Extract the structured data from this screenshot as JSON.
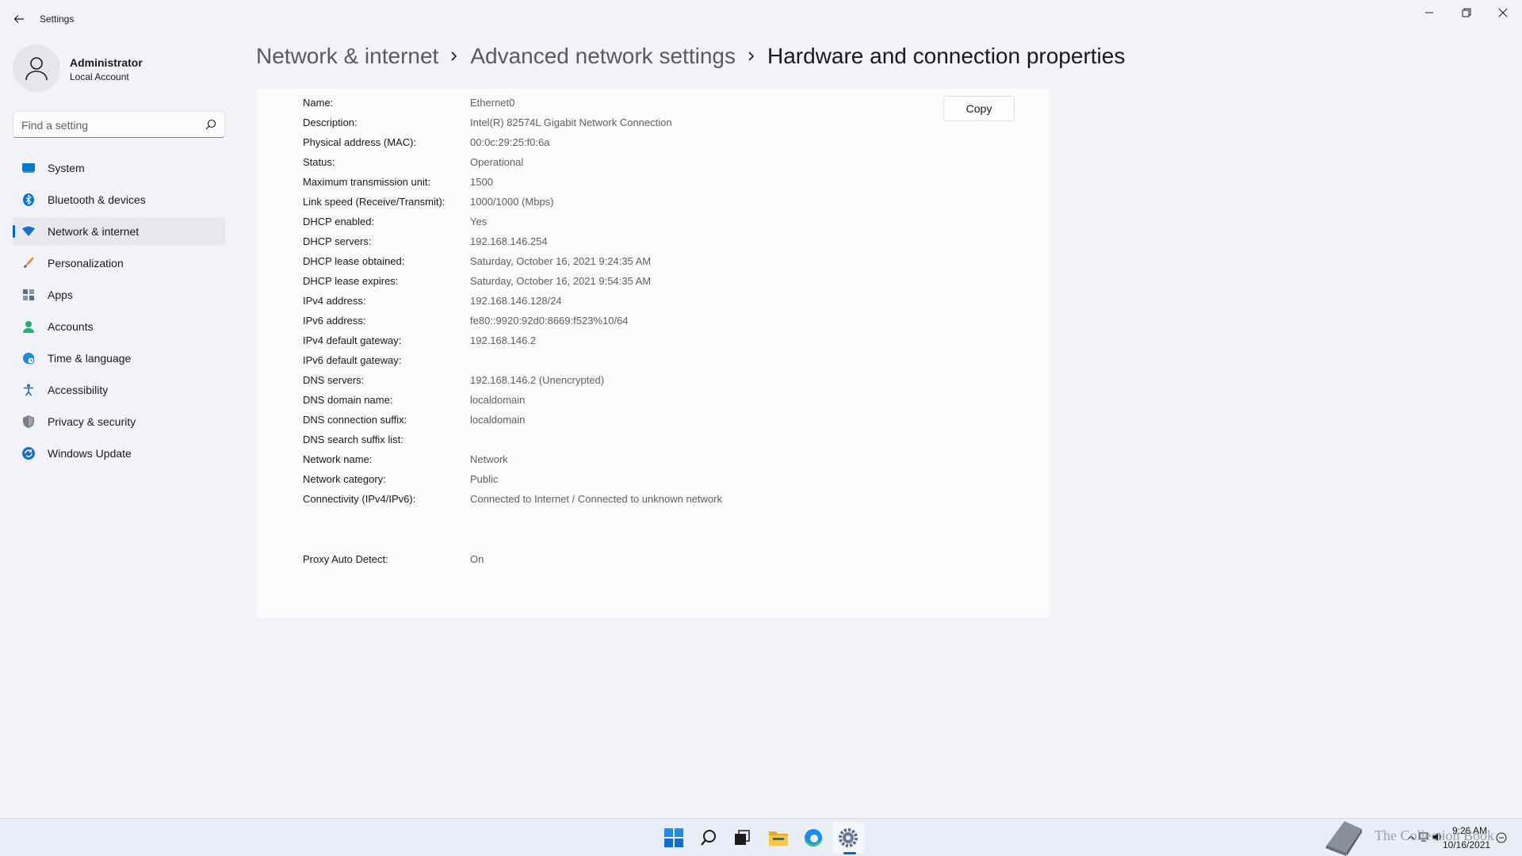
{
  "window": {
    "title": "Settings"
  },
  "profile": {
    "name": "Administrator",
    "subtitle": "Local Account"
  },
  "search": {
    "placeholder": "Find a setting"
  },
  "sidebar": {
    "items": [
      {
        "label": "System",
        "icon": "monitor-icon",
        "color": "#0078d4"
      },
      {
        "label": "Bluetooth & devices",
        "icon": "bluetooth-icon",
        "color": "#0078d4"
      },
      {
        "label": "Network & internet",
        "icon": "wifi-icon",
        "color": "#1b6fc2",
        "active": true
      },
      {
        "label": "Personalization",
        "icon": "brush-icon",
        "color": "#e08a3c"
      },
      {
        "label": "Apps",
        "icon": "apps-icon",
        "color": "#5b6b8a"
      },
      {
        "label": "Accounts",
        "icon": "person-icon",
        "color": "#2aa876"
      },
      {
        "label": "Time & language",
        "icon": "globe-clock-icon",
        "color": "#1b8fd6"
      },
      {
        "label": "Accessibility",
        "icon": "accessibility-icon",
        "color": "#1b6fc2"
      },
      {
        "label": "Privacy & security",
        "icon": "shield-icon",
        "color": "#7a7f8a"
      },
      {
        "label": "Windows Update",
        "icon": "update-icon",
        "color": "#1b6fc2"
      }
    ]
  },
  "breadcrumb": {
    "items": [
      "Network & internet",
      "Advanced network settings"
    ],
    "current": "Hardware and connection properties"
  },
  "panel": {
    "copy_label": "Copy",
    "properties": [
      {
        "label": "Name:",
        "value": "Ethernet0"
      },
      {
        "label": "Description:",
        "value": "Intel(R) 82574L Gigabit Network Connection"
      },
      {
        "label": "Physical address (MAC):",
        "value": "00:0c:29:25:f0:6a"
      },
      {
        "label": "Status:",
        "value": "Operational"
      },
      {
        "label": "Maximum transmission unit:",
        "value": "1500"
      },
      {
        "label": "Link speed (Receive/Transmit):",
        "value": "1000/1000 (Mbps)"
      },
      {
        "label": "DHCP enabled:",
        "value": "Yes"
      },
      {
        "label": "DHCP servers:",
        "value": "192.168.146.254"
      },
      {
        "label": "DHCP lease obtained:",
        "value": "Saturday, October 16, 2021 9:24:35 AM"
      },
      {
        "label": "DHCP lease expires:",
        "value": "Saturday, October 16, 2021 9:54:35 AM"
      },
      {
        "label": "IPv4 address:",
        "value": "192.168.146.128/24"
      },
      {
        "label": "IPv6 address:",
        "value": "fe80::9920:92d0:8669:f523%10/64"
      },
      {
        "label": "IPv4 default gateway:",
        "value": "192.168.146.2"
      },
      {
        "label": "IPv6 default gateway:",
        "value": ""
      },
      {
        "label": "DNS servers:",
        "value": "192.168.146.2 (Unencrypted)"
      },
      {
        "label": "DNS domain name:",
        "value": "localdomain"
      },
      {
        "label": "DNS connection suffix:",
        "value": "localdomain"
      },
      {
        "label": "DNS search suffix list:",
        "value": ""
      },
      {
        "label": "Network name:",
        "value": "Network"
      },
      {
        "label": "Network category:",
        "value": "Public"
      },
      {
        "label": "Connectivity (IPv4/IPv6):",
        "value": "Connected to Internet / Connected to unknown network"
      }
    ],
    "proxy": {
      "label": "Proxy Auto Detect:",
      "value": "On"
    }
  },
  "taskbar": {
    "apps": [
      "start-icon",
      "search-icon",
      "task-view-icon",
      "file-explorer-icon",
      "edge-icon",
      "settings-icon"
    ],
    "active_app": "settings-icon",
    "time": "9:26 AM",
    "date": "10/16/2021"
  },
  "watermark": {
    "text": "The Collection Book"
  }
}
